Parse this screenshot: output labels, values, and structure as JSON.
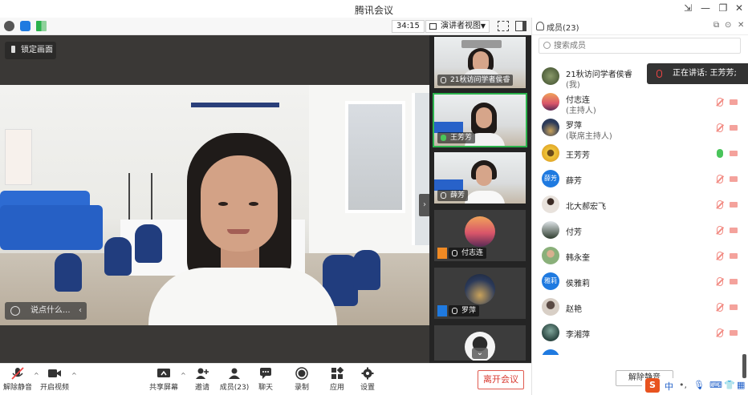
{
  "window": {
    "title": "腾讯会议"
  },
  "toolbar": {
    "timer": "34:15",
    "view_mode": "演讲者视图"
  },
  "stage": {
    "lock_label": "锁定画面",
    "chat_placeholder": "说点什么..."
  },
  "thumbnails": [
    {
      "name": "21秋访问学者侯睿",
      "type": "video",
      "active": false
    },
    {
      "name": "王芳芳",
      "type": "video",
      "active": true
    },
    {
      "name": "薛芳",
      "type": "video",
      "active": false
    },
    {
      "name": "付志连",
      "type": "avatar",
      "role": "host",
      "avatar_color": "#e27a6b"
    },
    {
      "name": "罗萍",
      "type": "avatar",
      "role": "cohost",
      "avatar_color": "#2e3b5a"
    },
    {
      "name": "",
      "type": "avatar",
      "avatar_color": "#f2f2f2"
    }
  ],
  "bottom_toolbar": {
    "unmute": "解除静音",
    "start_video": "开启视频",
    "share_screen": "共享屏幕",
    "invite": "邀请",
    "members": "成员(23)",
    "chat": "聊天",
    "record": "录制",
    "apps": "应用",
    "settings": "设置",
    "leave": "离开会议"
  },
  "panel": {
    "title": "成员(23)",
    "search_placeholder": "搜索成员",
    "speaking_label": "正在讲话: 王芳芳;",
    "unmute_all": "解除静音",
    "members": [
      {
        "name": "21秋访问学者侯睿",
        "role": "(我)",
        "avatar_color": "#4a5a3c",
        "mic": "none",
        "cam": "none"
      },
      {
        "name": "付志连",
        "role": "(主持人)",
        "avatar_color": "#e27a6b",
        "mic": "muted",
        "cam": "off"
      },
      {
        "name": "罗萍",
        "role": "(联席主持人)",
        "avatar_color": "#2e3b5a",
        "mic": "muted",
        "cam": "off"
      },
      {
        "name": "王芳芳",
        "role": "",
        "avatar_color": "#e2c23a",
        "mic": "on",
        "cam": "off"
      },
      {
        "name": "薛芳",
        "role": "",
        "avatar_text": "薛芳",
        "avatar_color": "#1f7ae0",
        "mic": "muted",
        "cam": "off"
      },
      {
        "name": "北大郝宏飞",
        "role": "",
        "avatar_color": "#cfcfcf",
        "mic": "muted",
        "cam": "off"
      },
      {
        "name": "付芳",
        "role": "",
        "avatar_color": "#3a4a3a",
        "mic": "muted",
        "cam": "off"
      },
      {
        "name": "韩永奎",
        "role": "",
        "avatar_color": "#7aa36b",
        "mic": "muted",
        "cam": "off"
      },
      {
        "name": "侯雅莉",
        "role": "",
        "avatar_text": "雅莉",
        "avatar_color": "#1f7ae0",
        "mic": "muted",
        "cam": "off"
      },
      {
        "name": "赵艳",
        "role": "",
        "avatar_color": "#b8a89a",
        "mic": "muted",
        "cam": "off"
      },
      {
        "name": "李湘萍",
        "role": "",
        "avatar_color": "#3d5a52",
        "mic": "muted",
        "cam": "off"
      }
    ]
  },
  "ime": {
    "lang": "中"
  }
}
